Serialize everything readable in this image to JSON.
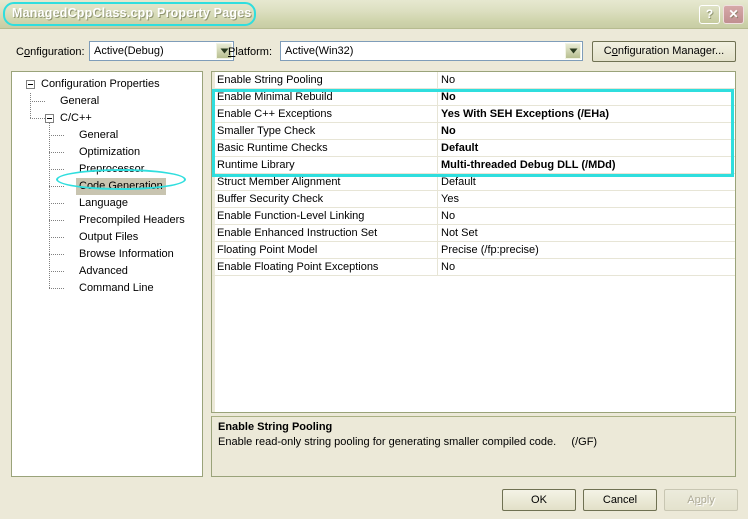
{
  "window": {
    "title": "ManagedCppClass.cpp Property Pages",
    "help_button": "?",
    "close_button": "✕",
    "annotation_color": "#2fdede",
    "titlebar_color": "#d4d8b0",
    "dialog_background": "#ece9d8"
  },
  "toolbar": {
    "configuration_label_pre": "C",
    "configuration_label_acc": "o",
    "configuration_label_post": "nfiguration:",
    "configuration_value": "Active(Debug)",
    "platform_label_pre": "",
    "platform_label_acc": "P",
    "platform_label_post": "latform:",
    "platform_value": "Active(Win32)",
    "config_manager_pre": "C",
    "config_manager_acc": "o",
    "config_manager_post": "nfiguration Manager..."
  },
  "tree": {
    "items": [
      {
        "label": "Configuration Properties",
        "level": 0,
        "expanded": true,
        "selected": false
      },
      {
        "label": "General",
        "level": 1,
        "expanded": null,
        "selected": false
      },
      {
        "label": "C/C++",
        "level": 1,
        "expanded": true,
        "selected": false
      },
      {
        "label": "General",
        "level": 2,
        "expanded": null,
        "selected": false
      },
      {
        "label": "Optimization",
        "level": 2,
        "expanded": null,
        "selected": false
      },
      {
        "label": "Preprocessor",
        "level": 2,
        "expanded": null,
        "selected": false
      },
      {
        "label": "Code Generation",
        "level": 2,
        "expanded": null,
        "selected": true
      },
      {
        "label": "Language",
        "level": 2,
        "expanded": null,
        "selected": false
      },
      {
        "label": "Precompiled Headers",
        "level": 2,
        "expanded": null,
        "selected": false
      },
      {
        "label": "Output Files",
        "level": 2,
        "expanded": null,
        "selected": false
      },
      {
        "label": "Browse Information",
        "level": 2,
        "expanded": null,
        "selected": false
      },
      {
        "label": "Advanced",
        "level": 2,
        "expanded": null,
        "selected": false
      },
      {
        "label": "Command Line",
        "level": 2,
        "expanded": null,
        "selected": false
      }
    ]
  },
  "grid": {
    "rows": [
      {
        "name": "Enable String Pooling",
        "value": "No",
        "highlighted": false
      },
      {
        "name": "Enable Minimal Rebuild",
        "value": "No",
        "highlighted": true
      },
      {
        "name": "Enable C++ Exceptions",
        "value": "Yes With SEH Exceptions (/EHa)",
        "highlighted": true
      },
      {
        "name": "Smaller Type Check",
        "value": "No",
        "highlighted": true
      },
      {
        "name": "Basic Runtime Checks",
        "value": "Default",
        "highlighted": true
      },
      {
        "name": "Runtime Library",
        "value": "Multi-threaded Debug DLL (/MDd)",
        "highlighted": true
      },
      {
        "name": "Struct Member Alignment",
        "value": "Default",
        "highlighted": false
      },
      {
        "name": "Buffer Security Check",
        "value": "Yes",
        "highlighted": false
      },
      {
        "name": "Enable Function-Level Linking",
        "value": "No",
        "highlighted": false
      },
      {
        "name": "Enable Enhanced Instruction Set",
        "value": "Not Set",
        "highlighted": false
      },
      {
        "name": "Floating Point Model",
        "value": "Precise (/fp:precise)",
        "highlighted": false
      },
      {
        "name": "Enable Floating Point Exceptions",
        "value": "No",
        "highlighted": false
      }
    ]
  },
  "description": {
    "title": "Enable String Pooling",
    "body": "Enable read-only string pooling for generating smaller compiled code.     (/GF)"
  },
  "buttons": {
    "ok": "OK",
    "cancel": "Cancel",
    "apply_pre": "A",
    "apply_acc": "p",
    "apply_post": "ply",
    "apply_enabled": false
  }
}
